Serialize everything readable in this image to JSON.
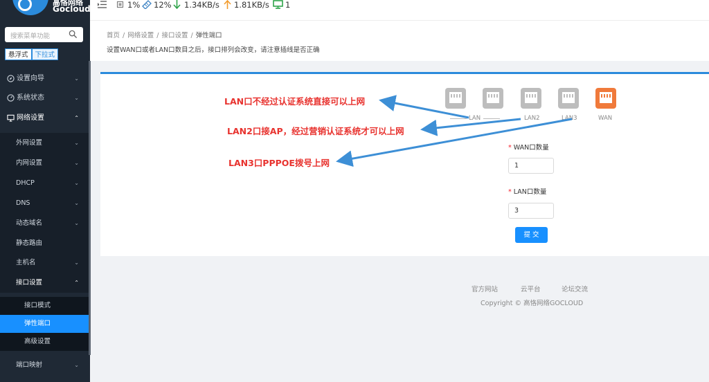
{
  "brand": {
    "name_cn": "高恪网络",
    "name_en": "Gocloud",
    "accent": "#2b8bdc"
  },
  "sidebar": {
    "search_placeholder": "搜索菜单功能",
    "mode_options": [
      "悬浮式",
      "下拉式"
    ],
    "items": [
      {
        "label": "设置向导",
        "icon": "compass-icon"
      },
      {
        "label": "系统状态",
        "icon": "dashboard-icon"
      },
      {
        "label": "网络设置",
        "icon": "monitor-icon",
        "expanded": true
      }
    ],
    "network_subitems": [
      "外网设置",
      "内网设置",
      "DHCP",
      "DNS",
      "动态域名",
      "静态路由",
      "主机名",
      "接口设置"
    ],
    "interface_subitems": [
      "接口模式",
      "弹性端口",
      "高级设置"
    ],
    "active_item": "弹性端口",
    "after_items": [
      "端口映射"
    ]
  },
  "topbar": {
    "cpu": "1%",
    "memory": "12%",
    "download": "1.34KB/s",
    "upload": "1.81KB/s",
    "online_devices": "1"
  },
  "breadcrumb": [
    "首页",
    "网络设置",
    "接口设置",
    "弹性端口"
  ],
  "description": "设置WAN口或者LAN口数目之后，接口排列会改变，请注意插线是否正确",
  "ports": {
    "group_label": "LAN",
    "labels": [
      "LAN2",
      "LAN3",
      "WAN"
    ]
  },
  "form": {
    "wan_label": "WAN口数量",
    "wan_value": "1",
    "lan_label": "LAN口数量",
    "lan_value": "3",
    "submit": "提 交"
  },
  "annotations": [
    "LAN口不经过认证系统直接可以上网",
    "LAN2口接AP，经过营销认证系统才可以上网",
    "LAN3口PPPOE拨号上网"
  ],
  "footer": {
    "links": [
      "官方网站",
      "云平台",
      "论坛交流"
    ],
    "copyright": "Copyright © 高恪网络GOCLOUD"
  },
  "colors": {
    "sidebar_bg": "#1f2935",
    "active": "#1890ff",
    "wan_port": "#f07a3b",
    "lan_port": "#bdbdbd",
    "annotation": "#e8332f",
    "arrow": "#3d8fd6"
  }
}
